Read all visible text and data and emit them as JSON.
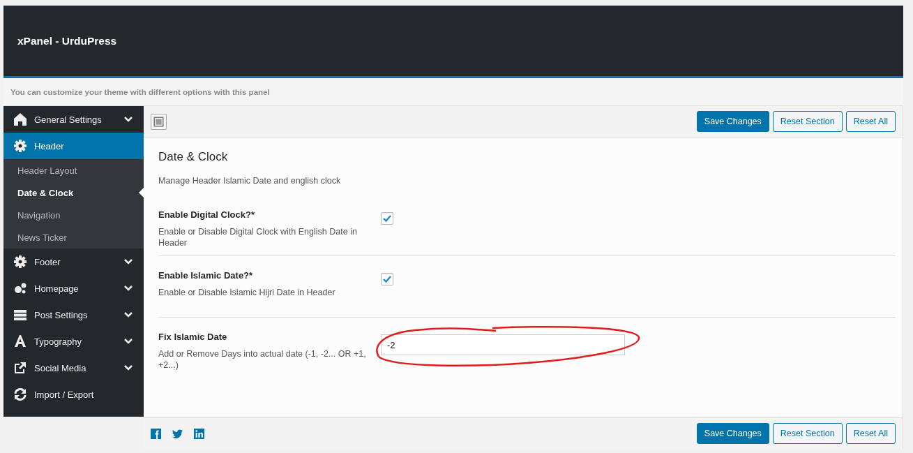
{
  "panel": {
    "title": "xPanel - UrduPress",
    "subtitle": "You can customize your theme with different options with this panel"
  },
  "sidebar": {
    "items": [
      {
        "label": "General Settings",
        "expandable": true,
        "selected": false
      },
      {
        "label": "Header",
        "expandable": false,
        "selected": true,
        "children": [
          {
            "label": "Header Layout",
            "selected": false
          },
          {
            "label": "Date & Clock",
            "selected": true
          },
          {
            "label": "Navigation",
            "selected": false
          },
          {
            "label": "News Ticker",
            "selected": false
          }
        ]
      },
      {
        "label": "Footer",
        "expandable": true,
        "selected": false
      },
      {
        "label": "Homepage",
        "expandable": true,
        "selected": false
      },
      {
        "label": "Post Settings",
        "expandable": true,
        "selected": false
      },
      {
        "label": "Typography",
        "expandable": true,
        "selected": false
      },
      {
        "label": "Social Media",
        "expandable": true,
        "selected": false
      },
      {
        "label": "Import / Export",
        "expandable": false,
        "selected": false
      }
    ]
  },
  "buttons": [
    {
      "label": "Save Changes",
      "kind": "primary"
    },
    {
      "label": "Reset Section",
      "kind": "secondary"
    },
    {
      "label": "Reset All",
      "kind": "secondary"
    }
  ],
  "section": {
    "title": "Date & Clock",
    "description": "Manage Header Islamic Date and english clock"
  },
  "fields": [
    {
      "kind": "checkbox",
      "label": "Enable Digital Clock?*",
      "description": "Enable or Disable Digital Clock with English Date in Header",
      "checked": true
    },
    {
      "kind": "checkbox",
      "label": "Enable Islamic Date?*",
      "description": "Enable or Disable Islamic Hijri Date in Header",
      "checked": true
    },
    {
      "kind": "text",
      "label": "Fix Islamic Date",
      "description": "Add or Remove Days into actual date (-1, -2... OR +1, +2...)",
      "value": "-2",
      "circled": true
    }
  ],
  "footer_buttons": [
    {
      "label": "Save Changes",
      "kind": "primary"
    },
    {
      "label": "Reset Section",
      "kind": "secondary"
    },
    {
      "label": "Reset All",
      "kind": "secondary"
    }
  ]
}
